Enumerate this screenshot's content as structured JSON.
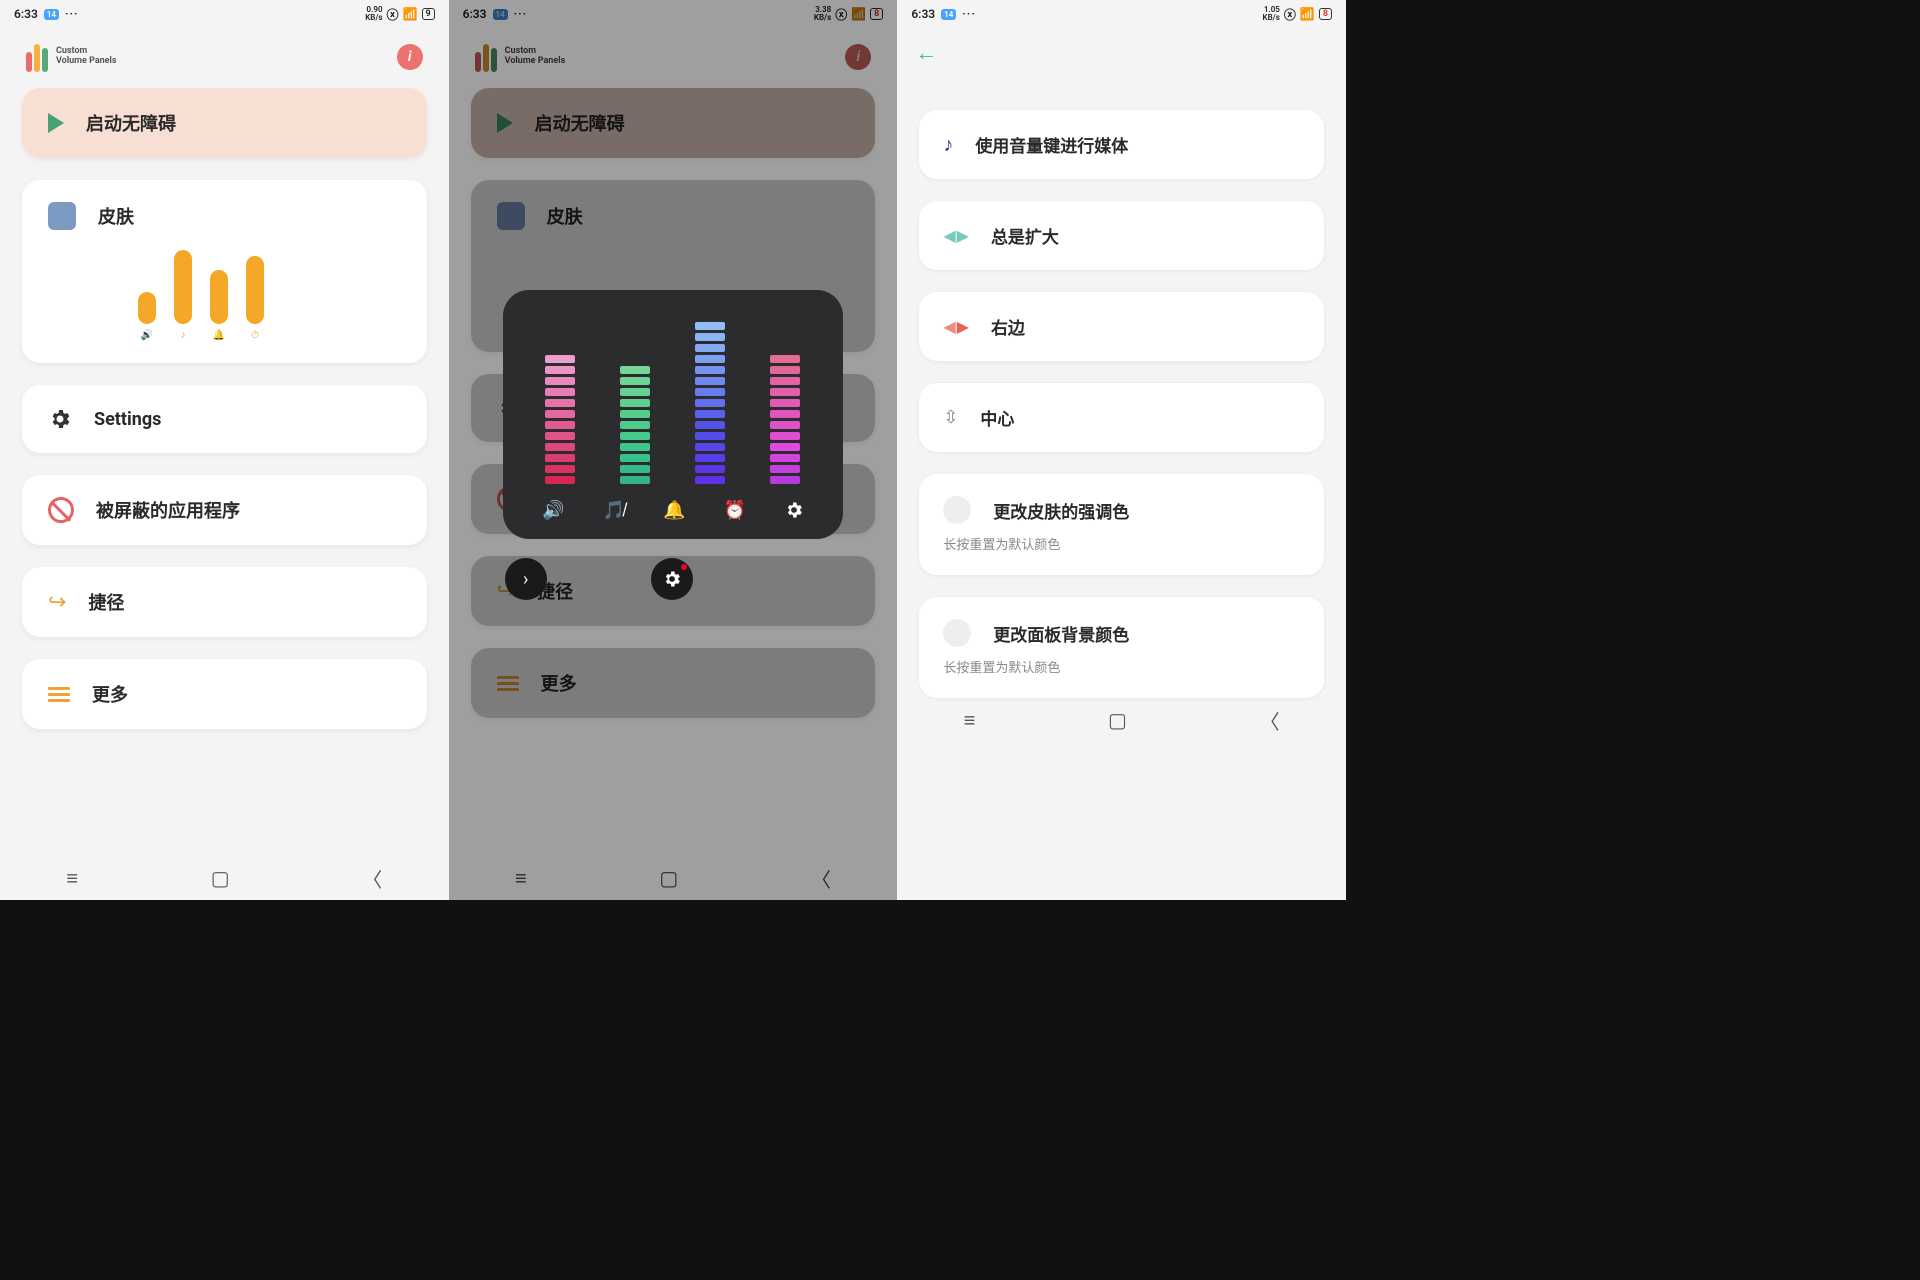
{
  "status": {
    "time": "6:33",
    "badge": "14",
    "dots": "···"
  },
  "status_r": {
    "p1": "0.90\nKB/s",
    "p2": "3.38\nKB/s",
    "p3": "1.05\nKB/s",
    "batt1": "9",
    "batt2": "8",
    "batt3": "8"
  },
  "logo": {
    "line1": "Custom",
    "line2": "Volume Panels"
  },
  "main": {
    "accessibility": "启动无障碍",
    "skin": "皮肤",
    "settings": "Settings",
    "blocked": "被屏蔽的应用程序",
    "shortcut": "捷径",
    "more": "更多"
  },
  "panel3": {
    "volkey": "使用音量键进行媒体",
    "expand": "总是扩大",
    "right": "右边",
    "center": "中心",
    "accent": "更改皮肤的强调色",
    "accent_sub": "长按重置为默认颜色",
    "bg": "更改面板背景颜色",
    "bg_sub": "长按重置为默认颜色"
  },
  "skin_icons": [
    "🔊",
    "♪",
    "🔔",
    "⏱"
  ],
  "vol_icons": [
    "🔊",
    "✕",
    "🔔",
    "⏰",
    "⚙"
  ]
}
